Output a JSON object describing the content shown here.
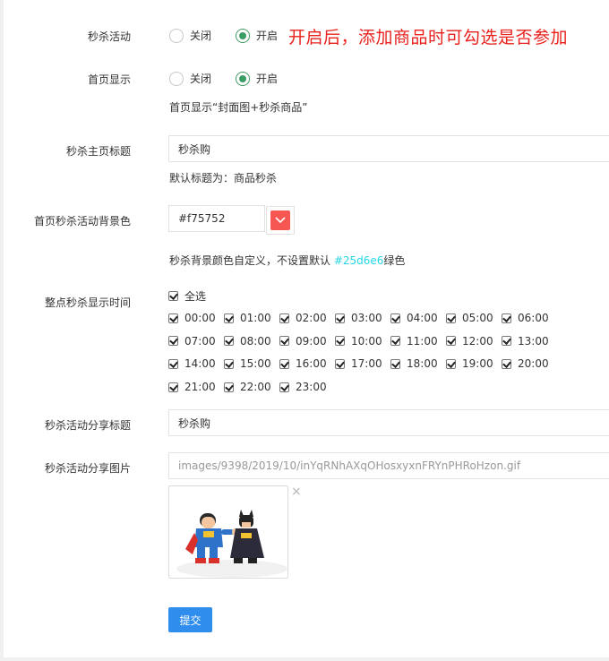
{
  "seckill": {
    "label": "秒杀活动",
    "off_label": "关闭",
    "on_label": "开启",
    "selected": "on",
    "annotation": "开启后，添加商品时可勾选是否参加"
  },
  "homepage": {
    "label": "首页显示",
    "off_label": "关闭",
    "on_label": "开启",
    "selected": "on",
    "hint": "首页显示“封面图+秒杀商品”"
  },
  "main_title": {
    "label": "秒杀主页标题",
    "value": "秒杀购",
    "hint": "默认标题为：商品秒杀"
  },
  "bg_color": {
    "label": "首页秒杀活动背景色",
    "value": "#f75752",
    "swatch_color": "#f75752",
    "hint_before": "秒杀背景颜色自定义，不设置默认 ",
    "hint_accent": "#25d6e6",
    "hint_after": "绿色",
    "accent_color": "#25d6e6"
  },
  "time_slots": {
    "label": "整点秒杀显示时间",
    "select_all": "全选",
    "times": [
      "00:00",
      "01:00",
      "02:00",
      "03:00",
      "04:00",
      "05:00",
      "06:00",
      "07:00",
      "08:00",
      "09:00",
      "10:00",
      "11:00",
      "12:00",
      "13:00",
      "14:00",
      "15:00",
      "16:00",
      "17:00",
      "18:00",
      "19:00",
      "20:00",
      "21:00",
      "22:00",
      "23:00"
    ]
  },
  "share_title": {
    "label": "秒杀活动分享标题",
    "value": "秒杀购"
  },
  "share_image": {
    "label": "秒杀活动分享图片",
    "path": "images/9398/2019/10/inYqRNhAXqOHosxyxnFRYnPHRoHzon.gif",
    "remove_symbol": "×"
  },
  "submit_label": "提交",
  "colors": {
    "primary": "#2f8ded",
    "radio_on": "#3c9d63",
    "annotation": "#e8211c"
  }
}
